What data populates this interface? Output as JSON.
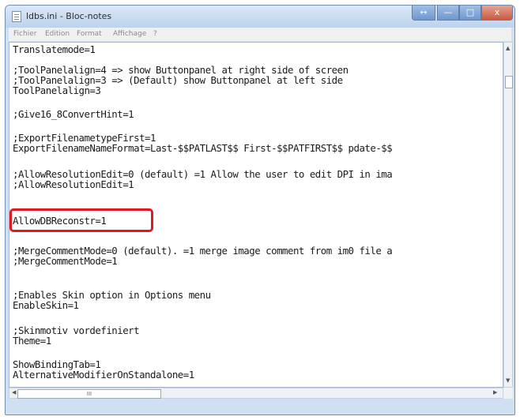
{
  "window": {
    "title": "ldbs.ini - Bloc-notes",
    "buttons": {
      "restore": "↔",
      "minimize": "—",
      "maximize": "□",
      "close": "x"
    }
  },
  "menu": [
    "Fichier",
    "Edition",
    "Format",
    "Affichage",
    "?"
  ],
  "lines": [
    "Translatemode=1",
    "",
    ";ToolPanelalign=4 => show Buttonpanel at right side of screen",
    ";ToolPanelalign=3 => (Default) show Buttonpanel at left side",
    "ToolPanelalign=3",
    "",
    ";Give16_8ConvertHint=1",
    "",
    ";ExportFilenametypeFirst=1",
    "ExportFilenameNameFormat=Last-$$PATLAST$$ First-$$PATFIRST$$ pdate-$$",
    "",
    ";AllowResolutionEdit=0 (default) =1 Allow the user to edit DPI in ima",
    ";AllowResolutionEdit=1",
    "",
    "AllowDBReconstr=1",
    "",
    ";MergeCommentMode=0 (default). =1 merge image comment from im0 file a",
    ";MergeCommentMode=1",
    "",
    "",
    ";Enables Skin option in Options menu",
    "EnableSkin=1",
    "",
    ";Skinmotiv vordefiniert",
    "Theme=1",
    "",
    "ShowBindingTab=1",
    "AlternativeModifierOnStandalone=1"
  ],
  "scroll": {
    "up": "▲",
    "down": "▼",
    "left": "◀",
    "right": "▶",
    "thumb_grip": "III"
  },
  "highlight_color": "#e0191f"
}
